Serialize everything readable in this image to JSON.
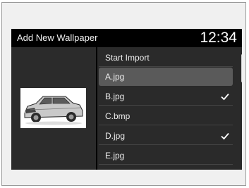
{
  "header": {
    "title": "Add New Wallpaper",
    "clock": "12:34"
  },
  "list": {
    "items": [
      {
        "label": "Start Import",
        "checked": false,
        "selected": false
      },
      {
        "label": "A.jpg",
        "checked": false,
        "selected": true
      },
      {
        "label": "B.jpg",
        "checked": true,
        "selected": false
      },
      {
        "label": "C.bmp",
        "checked": false,
        "selected": false
      },
      {
        "label": "D.jpg",
        "checked": true,
        "selected": false
      },
      {
        "label": "E.jpg",
        "checked": false,
        "selected": false
      }
    ]
  },
  "preview": {
    "image": "suv-car-thumbnail"
  },
  "icons": {
    "check": "check-icon"
  },
  "colors": {
    "screen_bg": "#000000",
    "list_bg": "#2a2a2a",
    "selected_bg": "#5a5a5a",
    "text": "#ececec"
  }
}
